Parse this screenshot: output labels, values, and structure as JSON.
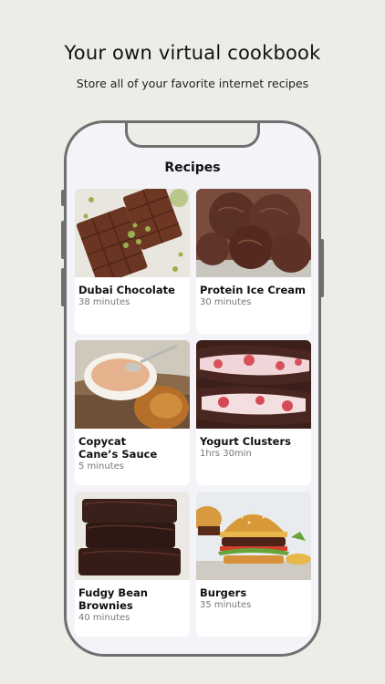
{
  "hero": {
    "title": "Your own virtual cookbook",
    "subtitle": "Store all of your favorite internet recipes"
  },
  "screen": {
    "title": "Recipes"
  },
  "recipes": [
    {
      "name": "Dubai Chocolate",
      "time": "38 minutes"
    },
    {
      "name": "Protein Ice Cream",
      "time": "30 minutes"
    },
    {
      "name": "Copycat\nCane’s Sauce",
      "time": "5 minutes"
    },
    {
      "name": "Yogurt Clusters",
      "time": "1hrs 30min"
    },
    {
      "name": "Fudgy Bean\nBrownies",
      "time": "40 minutes"
    },
    {
      "name": "Burgers",
      "time": "35 minutes"
    }
  ]
}
